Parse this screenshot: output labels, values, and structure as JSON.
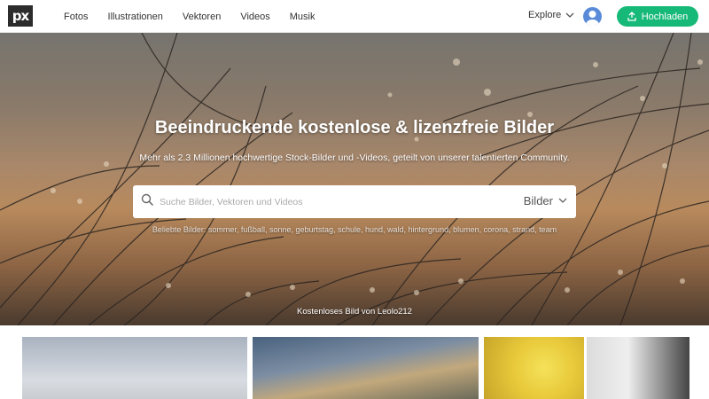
{
  "header": {
    "logo_text": "px",
    "nav": [
      "Fotos",
      "Illustrationen",
      "Vektoren",
      "Videos",
      "Musik"
    ],
    "explore_label": "Explore",
    "upload_label": "Hochladen",
    "accent_color": "#17b978"
  },
  "hero": {
    "title": "Beeindruckende kostenlose & lizenzfreie Bilder",
    "subtitle": "Mehr als 2.3 Millionen hochwertige Stock-Bilder und -Videos, geteilt von unserer talentierten Community.",
    "search_placeholder": "Suche Bilder, Vektoren und Videos",
    "search_type": "Bilder",
    "popular_label": "Beliebte Bilder:",
    "popular_terms": "sommer, fußball, sonne, geburtstag, schule, hund, wald, hintergrund, blumen, corona, strand, team",
    "credit": "Kostenloses Bild von Leolo212"
  }
}
